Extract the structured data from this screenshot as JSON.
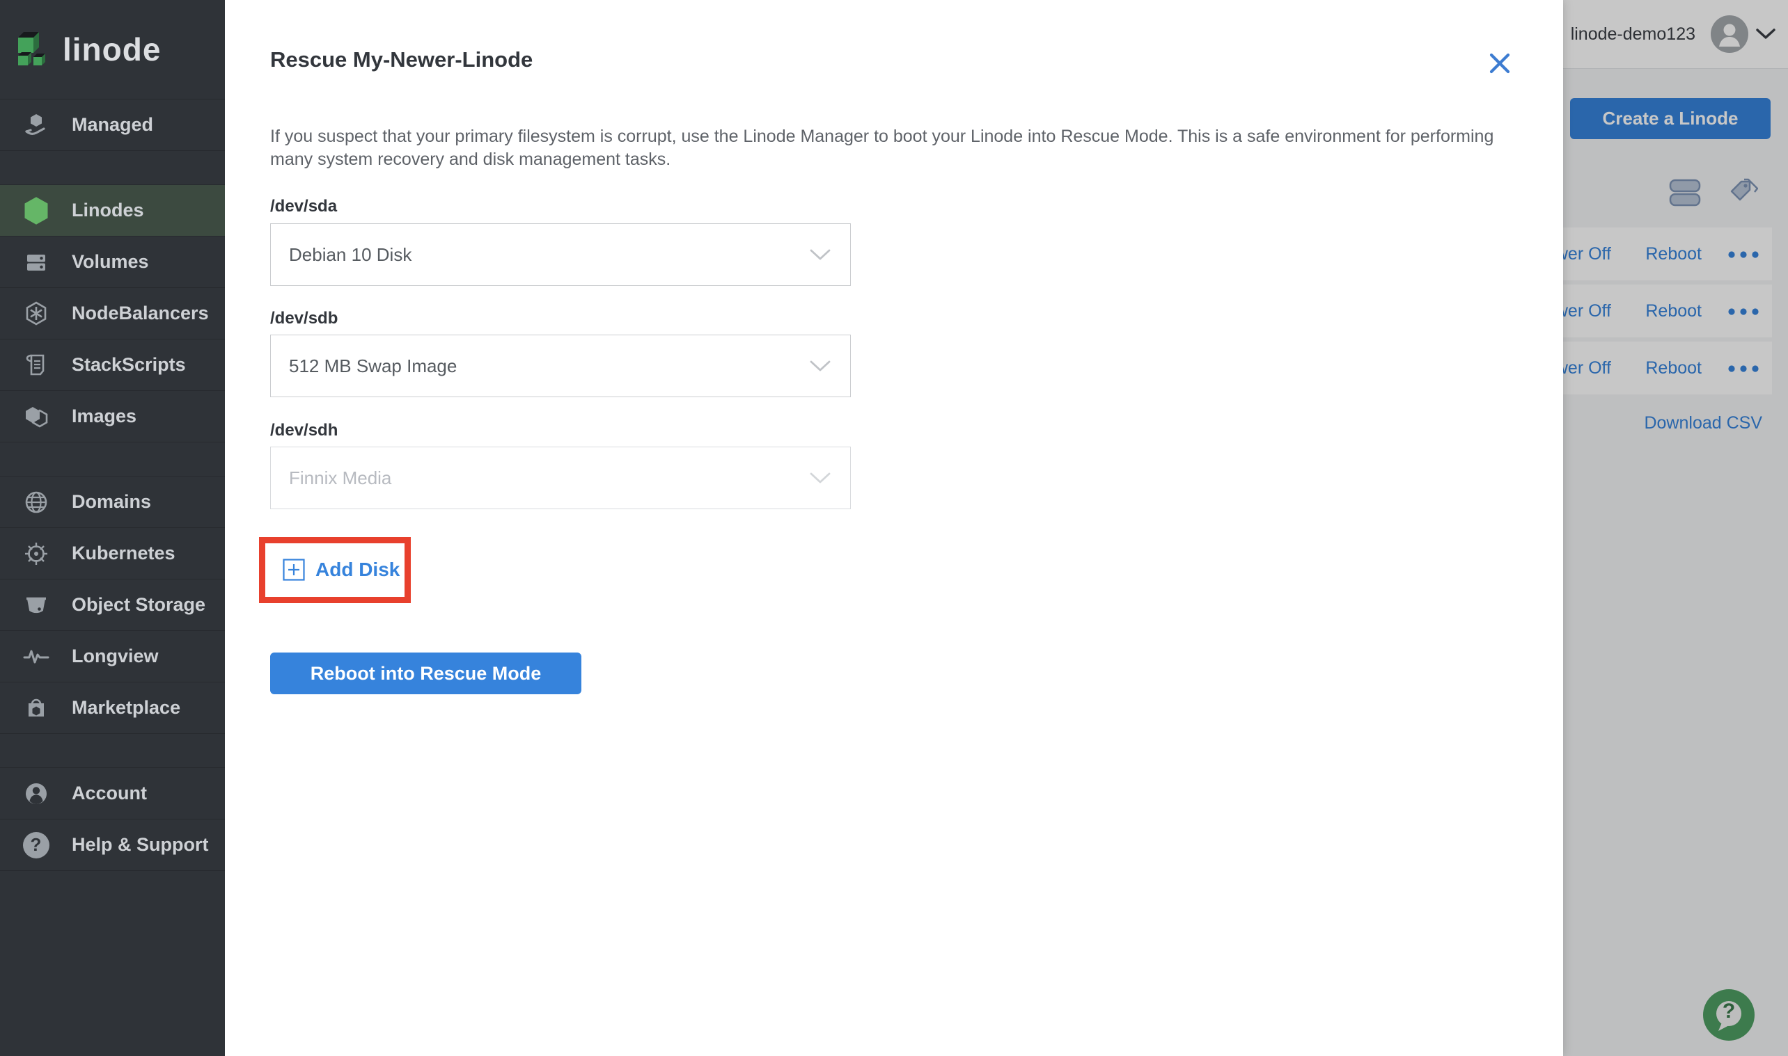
{
  "colors": {
    "accent_blue": "#3683dc",
    "sidebar_bg": "#2f3338",
    "sidebar_active_bg": "#3c4a40",
    "linode_green": "#65b667",
    "annotation_red": "#e8402d",
    "help_fab_green": "#4f9e63"
  },
  "sidebar": {
    "logo_text": "linode",
    "items": [
      {
        "label": "Managed",
        "icon": "managed-icon",
        "active": false
      },
      {
        "label": "Linodes",
        "icon": "linode-hexagon-icon",
        "active": true
      },
      {
        "label": "Volumes",
        "icon": "volumes-icon",
        "active": false
      },
      {
        "label": "NodeBalancers",
        "icon": "nodebalancers-icon",
        "active": false
      },
      {
        "label": "StackScripts",
        "icon": "stackscripts-icon",
        "active": false
      },
      {
        "label": "Images",
        "icon": "images-icon",
        "active": false
      },
      {
        "label": "Domains",
        "icon": "domains-icon",
        "active": false
      },
      {
        "label": "Kubernetes",
        "icon": "kubernetes-icon",
        "active": false
      },
      {
        "label": "Object Storage",
        "icon": "object-storage-icon",
        "active": false
      },
      {
        "label": "Longview",
        "icon": "longview-icon",
        "active": false
      },
      {
        "label": "Marketplace",
        "icon": "marketplace-icon",
        "active": false
      },
      {
        "label": "Account",
        "icon": "account-icon",
        "active": false
      },
      {
        "label": "Help & Support",
        "icon": "help-icon",
        "active": false
      }
    ]
  },
  "topbar": {
    "username": "linode-demo123",
    "avatar_icon": "user-avatar-icon",
    "chevron_icon": "chevron-down-icon"
  },
  "listing": {
    "create_button": "Create a Linode",
    "view_toggle_icons": [
      "summary-view-icon",
      "group-by-tag-icon"
    ],
    "rows": [
      {
        "power": "Power Off",
        "reboot": "Reboot",
        "more_icon": "more-actions-icon"
      },
      {
        "power": "Power Off",
        "reboot": "Reboot",
        "more_icon": "more-actions-icon"
      },
      {
        "power": "Power Off",
        "reboot": "Reboot",
        "more_icon": "more-actions-icon"
      }
    ],
    "download_csv": "Download CSV"
  },
  "drawer": {
    "title": "Rescue My-Newer-Linode",
    "close_icon": "close-icon",
    "description": "If you suspect that your primary filesystem is corrupt, use the Linode Manager to boot your Linode into Rescue Mode. This is a safe environment for performing many system recovery and disk management tasks.",
    "fields": [
      {
        "label": "/dev/sda",
        "value": "Debian 10 Disk",
        "disabled": false
      },
      {
        "label": "/dev/sdb",
        "value": "512 MB Swap Image",
        "disabled": false
      },
      {
        "label": "/dev/sdh",
        "value": "Finnix Media",
        "disabled": true
      }
    ],
    "add_disk_label": "Add Disk",
    "add_disk_icon": "plus-square-icon",
    "reboot_button": "Reboot into Rescue Mode"
  },
  "glyphs": {
    "question_mark": "?"
  },
  "help_fab": {
    "icon": "help-chat-icon"
  }
}
